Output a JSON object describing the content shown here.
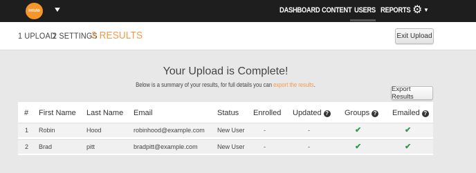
{
  "nav": {
    "logo_text": "intuto",
    "items": [
      "DASHBOARD",
      "CONTENT",
      "USERS",
      "REPORTS"
    ],
    "active": "USERS"
  },
  "steps": {
    "step1": "1 UPLOAD",
    "step2": "2 SETTINGS",
    "step3": "3 RESULTS",
    "exit_label": "Exit Upload"
  },
  "main": {
    "headline": "Your Upload is Complete!",
    "summary_prefix": "Below is a summary of your results, for full details you can ",
    "summary_link": "export the results",
    "summary_suffix": ".",
    "export_label": "Export Results"
  },
  "table": {
    "headers": [
      "#",
      "First Name",
      "Last Name",
      "Email",
      "Status",
      "Enrolled",
      "Updated",
      "Groups",
      "Emailed"
    ],
    "rows": [
      {
        "num": "1",
        "first": "Robin",
        "last": "Hood",
        "email": "robinhood@example.com",
        "status": "New User",
        "enrolled": "-",
        "updated": "-",
        "groups": "✔",
        "emailed": "✔"
      },
      {
        "num": "2",
        "first": "Brad",
        "last": "pitt",
        "email": "bradpitt@example.com",
        "status": "New User",
        "enrolled": "-",
        "updated": "-",
        "groups": "✔",
        "emailed": "✔"
      }
    ]
  },
  "colors": {
    "accent": "#f29a4c",
    "navbar": "#1e1e1e",
    "check": "#2e9a47"
  }
}
